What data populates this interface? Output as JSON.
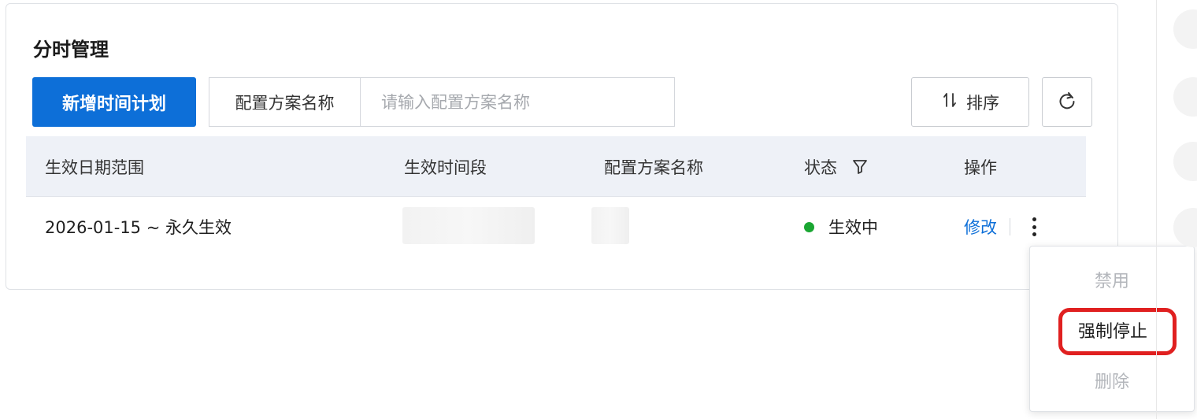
{
  "card": {
    "title": "分时管理"
  },
  "toolbar": {
    "add_button": "新增时间计划",
    "filter_label": "配置方案名称",
    "filter_placeholder": "请输入配置方案名称",
    "filter_value": "",
    "sort_label": "排序"
  },
  "table": {
    "columns": [
      "生效日期范围",
      "生效时间段",
      "配置方案名称",
      "状态",
      "操作"
    ],
    "rows": [
      {
        "date_range": "2026-01-15 ~ 永久生效",
        "status": "生效中",
        "status_color": "#1aa632",
        "action_edit": "修改"
      }
    ]
  },
  "menu": {
    "items": [
      {
        "label": "禁用",
        "state": "disabled"
      },
      {
        "label": "强制停止",
        "state": "enabled"
      },
      {
        "label": "删除",
        "state": "disabled"
      }
    ]
  },
  "colors": {
    "primary": "#0d6fd8",
    "highlight": "#e02020"
  }
}
